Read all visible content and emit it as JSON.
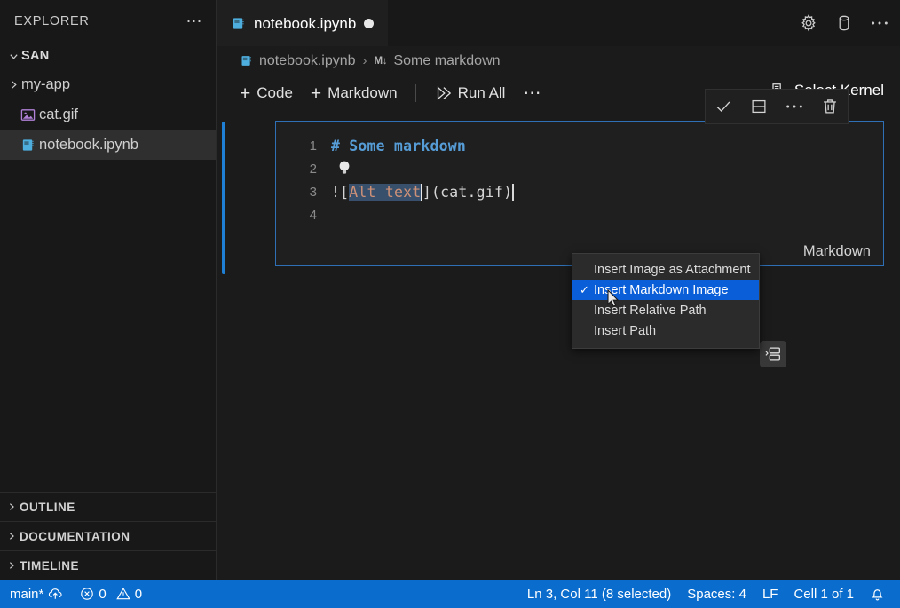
{
  "sidebar": {
    "header": {
      "title": "EXPLORER",
      "more_icon": "ellipsis-icon"
    },
    "root_folder": "SAN",
    "items": [
      {
        "label": "my-app",
        "icon": "chevron-right-icon",
        "type": "folder"
      },
      {
        "label": "cat.gif",
        "icon": "image-file-icon",
        "type": "file"
      },
      {
        "label": "notebook.ipynb",
        "icon": "notebook-file-icon",
        "type": "file",
        "selected": true
      }
    ],
    "sections": [
      {
        "label": "OUTLINE"
      },
      {
        "label": "DOCUMENTATION"
      },
      {
        "label": "TIMELINE"
      }
    ]
  },
  "editor": {
    "tab": {
      "label": "notebook.ipynb",
      "icon": "notebook-file-icon",
      "dirty": true
    },
    "tab_actions": [
      {
        "name": "gear-icon"
      },
      {
        "name": "database-icon"
      },
      {
        "name": "ellipsis-icon"
      }
    ],
    "breadcrumb": {
      "file": "notebook.ipynb",
      "separator": "›",
      "cell_badge": "M↓",
      "cell": "Some markdown"
    },
    "toolbar": {
      "add_code": "Code",
      "add_markdown": "Markdown",
      "run_all": "Run All",
      "more": "⋯",
      "plus": "+",
      "select_kernel": "Select Kernel"
    }
  },
  "cell": {
    "language": "Markdown",
    "toolbar_icons": [
      {
        "name": "check-icon"
      },
      {
        "name": "split-cell-icon"
      },
      {
        "name": "ellipsis-icon"
      },
      {
        "name": "trash-icon"
      }
    ],
    "lines": [
      {
        "number": "1",
        "text": "# Some markdown"
      },
      {
        "number": "2",
        "text": ""
      },
      {
        "number": "3",
        "text": "![Alt text](cat.gif)"
      },
      {
        "number": "4",
        "text": ""
      }
    ],
    "line3": {
      "prefix": "![",
      "selected": "Alt text",
      "middle": "](",
      "link": "cat.gif",
      "suffix": ")"
    },
    "lightbulb_icon": "lightbulb-icon",
    "image_widget_icon": "insert-image-widget-icon"
  },
  "context_menu": {
    "items": [
      {
        "label": "Insert Image as Attachment",
        "checked": false
      },
      {
        "label": "Insert Markdown Image",
        "checked": true
      },
      {
        "label": "Insert Relative Path",
        "checked": false
      },
      {
        "label": "Insert Path",
        "checked": false
      }
    ],
    "check_glyph": "✓"
  },
  "status_bar": {
    "branch": "main*",
    "sync_icon": "sync-cloud-icon",
    "errors": "0",
    "warnings": "0",
    "cursor": "Ln 3, Col 11 (8 selected)",
    "spaces": "Spaces: 4",
    "eol": "LF",
    "cell_position": "Cell 1 of 1",
    "bell_icon": "bell-icon"
  },
  "colors": {
    "accent_blue": "#0a6ccd",
    "menu_highlight": "#0a5ed7",
    "cell_border": "#2f6fb5",
    "active_cell_bar": "#1f7fd4",
    "editor_bg": "#1b1b1b",
    "sidebar_bg": "#181818",
    "selection_bg": "#38506b",
    "alt_text_color": "#ce9178",
    "heading_color": "#569cd6"
  }
}
